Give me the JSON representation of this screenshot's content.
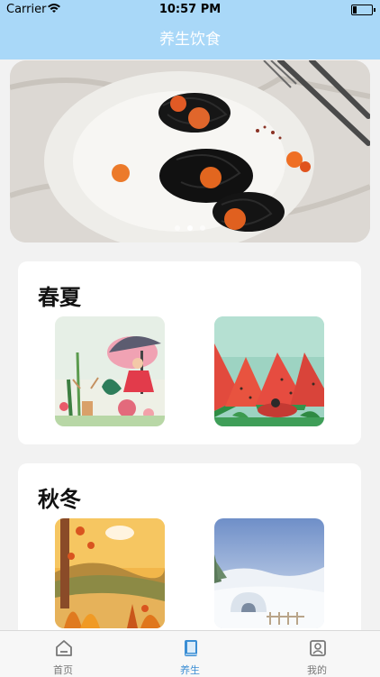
{
  "status_bar": {
    "carrier": "Carrier",
    "time": "10:57 PM"
  },
  "nav": {
    "title": "养生饮食"
  },
  "banner": {
    "page_count": 3,
    "active_page": 2
  },
  "sections": [
    {
      "title": "春夏",
      "images": [
        "spring-illustration",
        "summer-watermelon-illustration"
      ]
    },
    {
      "title": "秋冬",
      "images": [
        "autumn-illustration",
        "winter-igloo-illustration"
      ]
    }
  ],
  "tabbar": {
    "items": [
      {
        "label": "首页",
        "icon": "home-icon"
      },
      {
        "label": "养生",
        "icon": "book-icon",
        "active": true
      },
      {
        "label": "我的",
        "icon": "profile-icon"
      }
    ],
    "active_color": "#3b8ed4"
  },
  "colors": {
    "header": "#a9d8f8",
    "background": "#f2f2f2"
  }
}
